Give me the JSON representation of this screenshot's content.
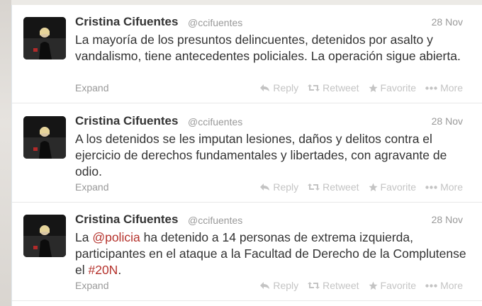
{
  "tweets": [
    {
      "name": "Cristina Cifuentes",
      "handle": "@ccifuentes",
      "date": "28 Nov",
      "text_parts": [
        {
          "t": "La mayoría de los presuntos delincuentes, detenidos por asalto y vandalismo, tiene antecedentes policiales. La operación sigue abierta.",
          "link": false
        }
      ],
      "expand": "Expand",
      "reply": "Reply",
      "retweet": "Retweet",
      "favorite": "Favorite",
      "more": "More"
    },
    {
      "name": "Cristina Cifuentes",
      "handle": "@ccifuentes",
      "date": "28 Nov",
      "text_parts": [
        {
          "t": "A los detenidos se les imputan lesiones, daños y delitos contra el ejercicio de derechos fundamentales y libertades, con agravante de odio.",
          "link": false
        }
      ],
      "expand": "Expand",
      "reply": "Reply",
      "retweet": "Retweet",
      "favorite": "Favorite",
      "more": "More"
    },
    {
      "name": "Cristina Cifuentes",
      "handle": "@ccifuentes",
      "date": "28 Nov",
      "text_parts": [
        {
          "t": "La ",
          "link": false
        },
        {
          "t": "@policia",
          "link": true
        },
        {
          "t": " ha detenido a 14 personas de extrema izquierda, participantes en el ataque a la Facultad de Derecho de la Complutense el ",
          "link": false
        },
        {
          "t": "#20N",
          "link": true
        },
        {
          "t": ".",
          "link": false
        }
      ],
      "expand": "Expand",
      "reply": "Reply",
      "retweet": "Retweet",
      "favorite": "Favorite",
      "more": "More"
    }
  ],
  "colors": {
    "link": "#b5322c",
    "name": "#333333",
    "muted": "#999999",
    "action": "#c4c4c4"
  },
  "icons": [
    "reply-icon",
    "retweet-icon",
    "favorite-icon",
    "more-icon"
  ]
}
